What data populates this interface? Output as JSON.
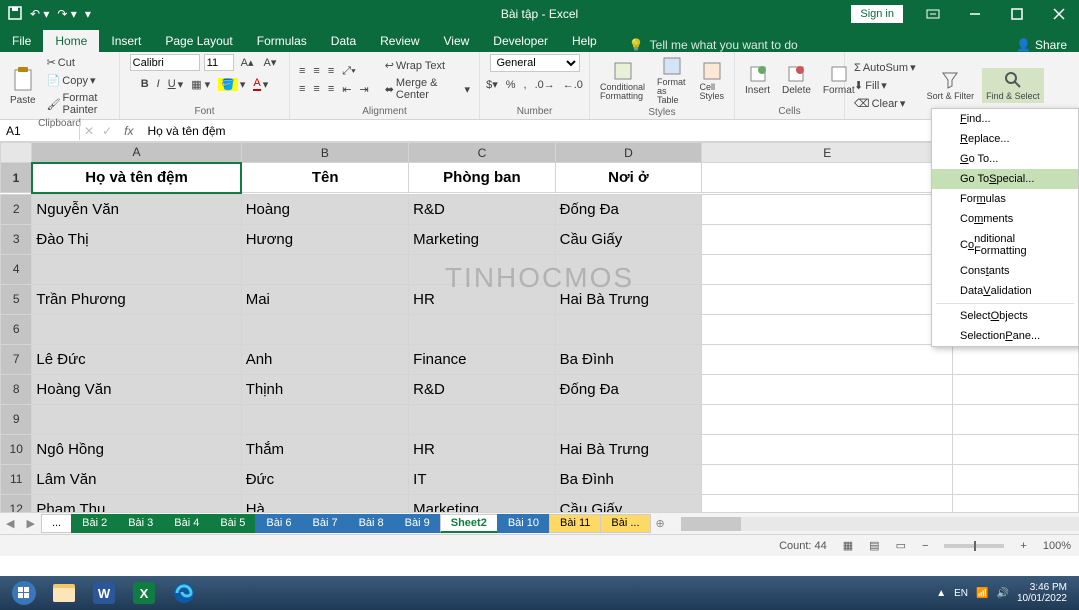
{
  "titlebar": {
    "title": "Bài tập - Excel",
    "signin": "Sign in"
  },
  "tabs": {
    "file": "File",
    "items": [
      "Home",
      "Insert",
      "Page Layout",
      "Formulas",
      "Data",
      "Review",
      "View",
      "Developer",
      "Help"
    ],
    "active": "Home",
    "tellme": "Tell me what you want to do",
    "share": "Share"
  },
  "ribbon": {
    "clipboard": {
      "label": "Clipboard",
      "paste": "Paste",
      "cut": "Cut",
      "copy": "Copy",
      "painter": "Format Painter"
    },
    "font": {
      "label": "Font",
      "name": "Calibri",
      "size": "11"
    },
    "alignment": {
      "label": "Alignment",
      "wrap": "Wrap Text",
      "merge": "Merge & Center"
    },
    "number": {
      "label": "Number",
      "format": "General"
    },
    "styles": {
      "label": "Styles",
      "cond": "Conditional Formatting",
      "table": "Format as Table",
      "cell": "Cell Styles"
    },
    "cells": {
      "label": "Cells",
      "insert": "Insert",
      "delete": "Delete",
      "format": "Format"
    },
    "editing": {
      "autosum": "AutoSum",
      "fill": "Fill",
      "clear": "Clear",
      "sort": "Sort & Filter",
      "find": "Find & Select"
    }
  },
  "formulabar": {
    "name": "A1",
    "fx": "fx",
    "formula": "Họ và tên đệm"
  },
  "columns": [
    "A",
    "B",
    "C",
    "D",
    "E"
  ],
  "headers": [
    "Họ và tên đệm",
    "Tên",
    "Phòng ban",
    "Nơi ở"
  ],
  "rows": [
    [
      "Nguyễn Văn",
      "Hoàng",
      "R&D",
      "Đống Đa"
    ],
    [
      "Đào Thị",
      "Hương",
      "Marketing",
      "Cầu Giấy"
    ],
    [
      "",
      "",
      "",
      ""
    ],
    [
      "Trần Phương",
      "Mai",
      "HR",
      "Hai Bà Trưng"
    ],
    [
      "",
      "",
      "",
      ""
    ],
    [
      "Lê Đức",
      "Anh",
      "Finance",
      "Ba Đình"
    ],
    [
      "Hoàng Văn",
      "Thịnh",
      "R&D",
      "Đống Đa"
    ],
    [
      "",
      "",
      "",
      ""
    ],
    [
      "Ngô Hồng",
      "Thắm",
      "HR",
      "Hai Bà Trưng"
    ],
    [
      "Lâm Văn",
      "Đức",
      "IT",
      "Ba Đình"
    ],
    [
      "Phạm Thu",
      "Hà",
      "Marketing",
      "Cầu Giấy"
    ]
  ],
  "watermark": "TINHOCMOS",
  "sheettabs": {
    "items": [
      {
        "label": "...",
        "cls": ""
      },
      {
        "label": "Bài 2",
        "cls": "green"
      },
      {
        "label": "Bài 3",
        "cls": "green"
      },
      {
        "label": "Bài 4",
        "cls": "green"
      },
      {
        "label": "Bài 5",
        "cls": "green"
      },
      {
        "label": "Bài 6",
        "cls": "blue"
      },
      {
        "label": "Bài 7",
        "cls": "blue"
      },
      {
        "label": "Bài 8",
        "cls": "blue"
      },
      {
        "label": "Bài 9",
        "cls": "blue"
      },
      {
        "label": "Sheet2",
        "cls": "active"
      },
      {
        "label": "Bài 10",
        "cls": "blue"
      },
      {
        "label": "Bài 11",
        "cls": "yellow"
      },
      {
        "label": "Bài ...",
        "cls": "yellow"
      }
    ]
  },
  "statusbar": {
    "count": "Count: 44",
    "zoom": "100%"
  },
  "dropdown": {
    "items": [
      {
        "label": "Find...",
        "u": 0
      },
      {
        "label": "Replace...",
        "u": 0
      },
      {
        "label": "Go To...",
        "u": 0
      },
      {
        "label": "Go To Special...",
        "u": 6,
        "hl": true
      },
      {
        "label": "Formulas",
        "u": 3
      },
      {
        "label": "Comments",
        "u": 2
      },
      {
        "label": "Conditional Formatting",
        "u": 1
      },
      {
        "label": "Constants",
        "u": 4
      },
      {
        "label": "Data Validation",
        "u": 5
      },
      {
        "label": "Select Objects",
        "u": 7
      },
      {
        "label": "Selection Pane...",
        "u": 10
      }
    ]
  },
  "taskbar": {
    "time": "3:46 PM",
    "date": "10/01/2022",
    "lang": "EN"
  }
}
